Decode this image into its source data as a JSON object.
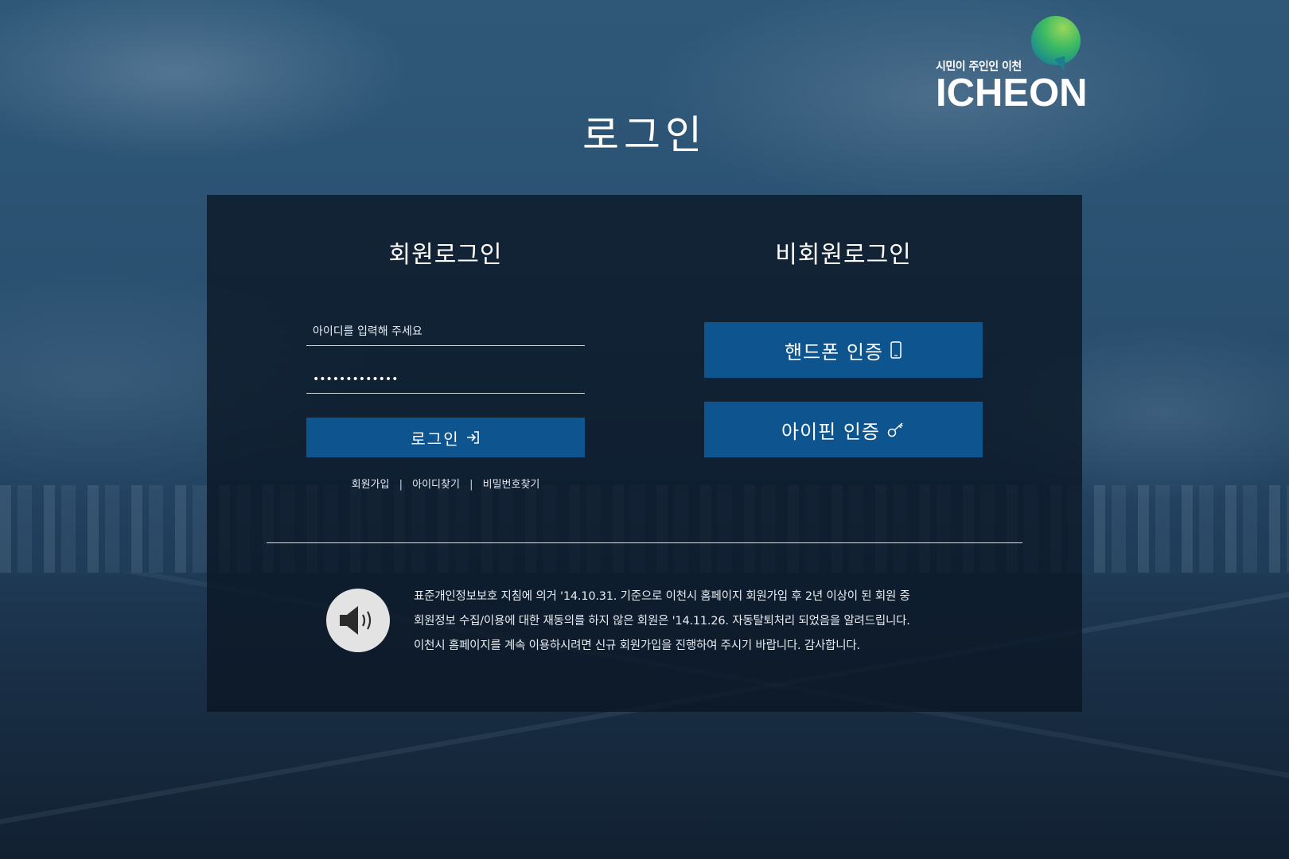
{
  "logo": {
    "slogan": "시민이 주인인 이천",
    "name": "ICHEON"
  },
  "page_title": "로그인",
  "member_login": {
    "title": "회원로그인",
    "id_placeholder": "아이디를 입력해 주세요",
    "password_value": "•••••••••••••",
    "login_button": "로그인",
    "links": {
      "signup": "회원가입",
      "find_id": "아이디찾기",
      "find_password": "비밀번호찾기",
      "separator": "|"
    }
  },
  "guest_login": {
    "title": "비회원로그인",
    "phone_auth": "핸드폰 인증",
    "ipin_auth": "아이핀 인증"
  },
  "notice": {
    "lines": [
      "표준개인정보보호 지침에 의거 '14.10.31. 기준으로 이천시 홈페이지 회원가입 후 2년 이상이 된 회원 중",
      "회원정보 수집/이용에 대한 재동의를 하지 않은 회원은 '14.11.26. 자동탈퇴처리 되었음을 알려드립니다.",
      "이천시 홈페이지를 계속 이용하시려면 신규 회원가입을 진행하여 주시기 바랍니다. 감사합니다."
    ]
  },
  "colors": {
    "button_blue": "#0e5590",
    "panel_bg": "#0a1624"
  },
  "icons": {
    "login": "login-arrow-icon",
    "phone": "smartphone-icon",
    "ipin": "key-icon",
    "notice": "speaker-icon"
  }
}
